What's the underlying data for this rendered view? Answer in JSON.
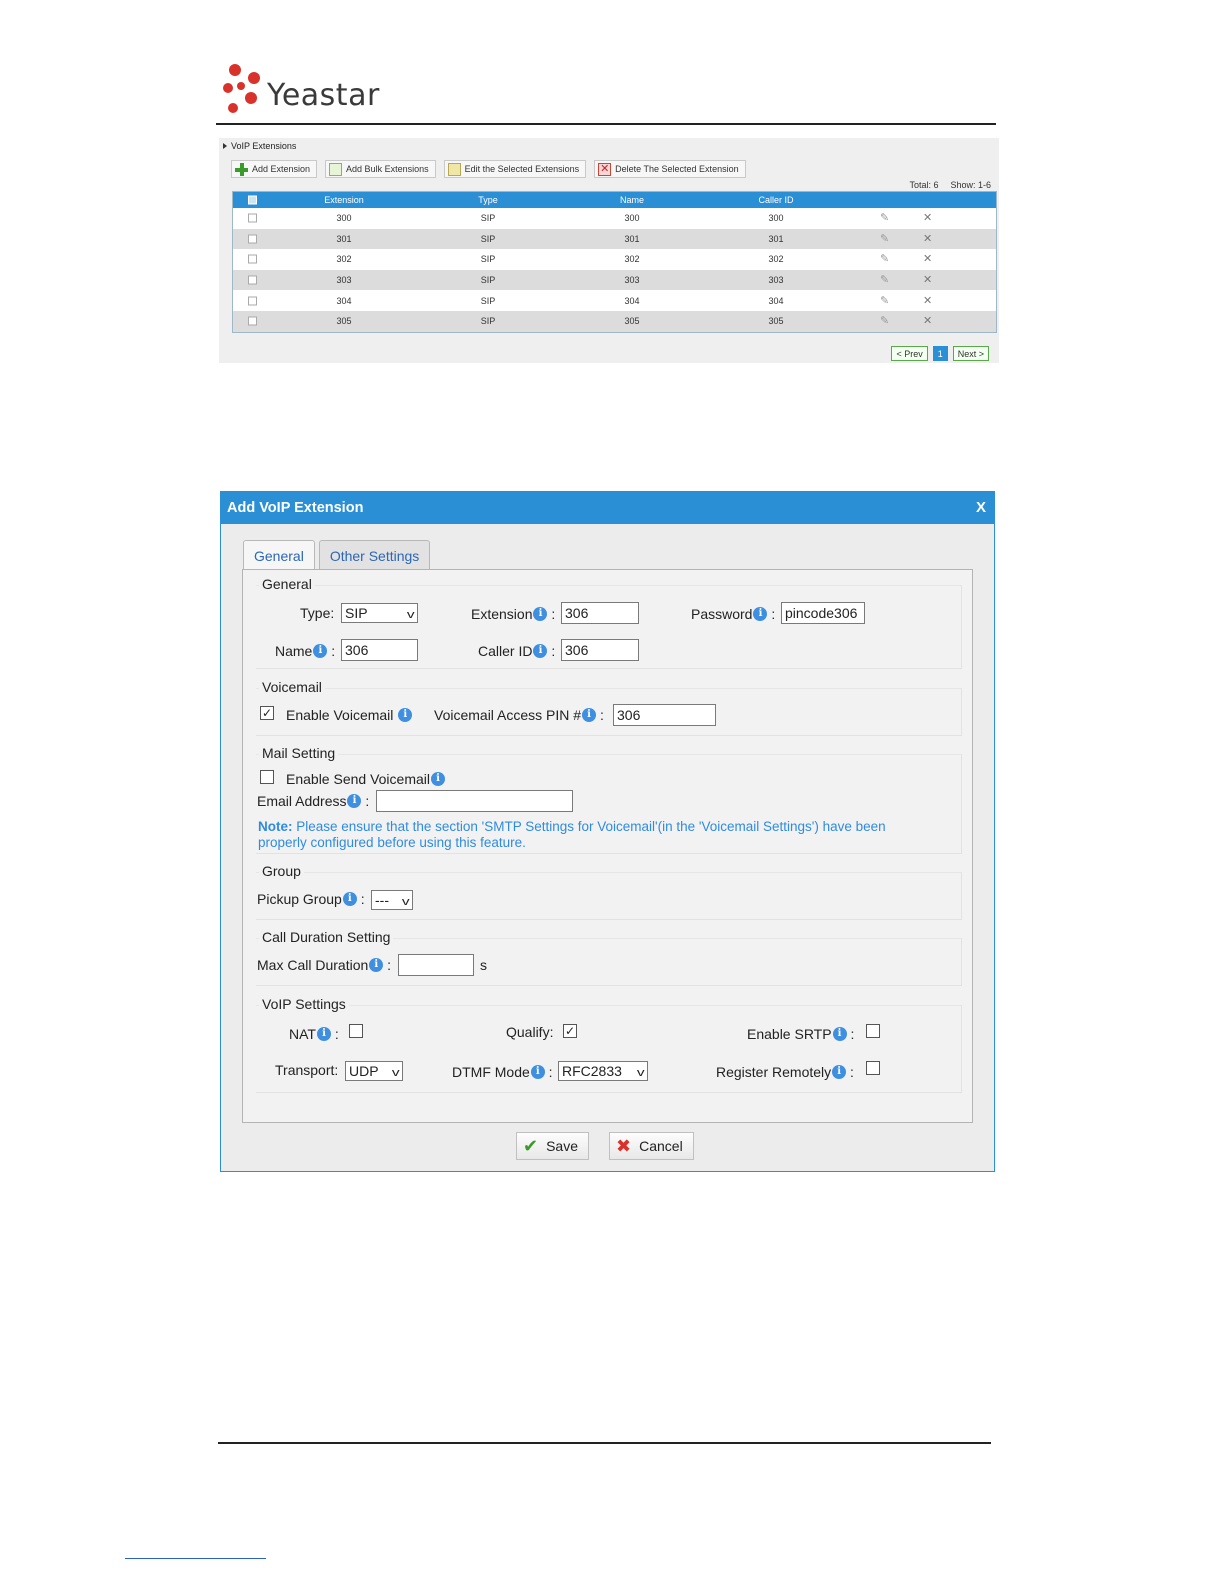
{
  "brand": {
    "name": "Yeastar",
    "accent": "#d8322b"
  },
  "ext_list": {
    "title": "VoIP Extensions",
    "toolbar": [
      {
        "label": "Add Extension",
        "icon": "plus-icon"
      },
      {
        "label": "Add Bulk Extensions",
        "icon": "bulk-icon"
      },
      {
        "label": "Edit the Selected Extensions",
        "icon": "edit-icon"
      },
      {
        "label": "Delete The Selected Extension",
        "icon": "delete-icon"
      }
    ],
    "total": "Total: 6",
    "show": "Show: 1-6",
    "columns": [
      "Extension",
      "Type",
      "Name",
      "Caller ID"
    ],
    "rows": [
      {
        "extension": "300",
        "type": "SIP",
        "name": "300",
        "caller_id": "300"
      },
      {
        "extension": "301",
        "type": "SIP",
        "name": "301",
        "caller_id": "301"
      },
      {
        "extension": "302",
        "type": "SIP",
        "name": "302",
        "caller_id": "302"
      },
      {
        "extension": "303",
        "type": "SIP",
        "name": "303",
        "caller_id": "303"
      },
      {
        "extension": "304",
        "type": "SIP",
        "name": "304",
        "caller_id": "304"
      },
      {
        "extension": "305",
        "type": "SIP",
        "name": "305",
        "caller_id": "305"
      }
    ],
    "pager": {
      "prev": "< Prev",
      "page": "1",
      "next": "Next >"
    }
  },
  "dialog": {
    "title": "Add VoIP Extension",
    "close": "X",
    "tabs": [
      "General",
      "Other Settings"
    ],
    "general": {
      "legend": "General",
      "type_label": "Type:",
      "type_value": "SIP",
      "extension_label": "Extension",
      "extension_value": "306",
      "password_label": "Password",
      "password_value": "pincode306",
      "name_label": "Name",
      "name_value": "306",
      "caller_id_label": "Caller ID",
      "caller_id_value": "306"
    },
    "voicemail": {
      "legend": "Voicemail",
      "enable_label": "Enable Voicemail",
      "enable_checked": true,
      "pin_label": "Voicemail Access PIN #",
      "pin_value": "306"
    },
    "mail": {
      "legend": "Mail Setting",
      "send_label": "Enable Send Voicemail",
      "send_checked": false,
      "email_label": "Email Address",
      "email_value": "",
      "note_prefix": "Note:",
      "note_text": " Please ensure that the section 'SMTP Settings for Voicemail'(in the 'Voicemail Settings') have been properly configured before using this feature."
    },
    "group": {
      "legend": "Group",
      "pickup_label": "Pickup Group",
      "pickup_value": "---"
    },
    "call_duration": {
      "legend": "Call Duration Setting",
      "max_label": "Max Call Duration",
      "max_value": "",
      "unit": "s"
    },
    "voip": {
      "legend": "VoIP Settings",
      "nat_label": "NAT",
      "nat_checked": false,
      "qualify_label": "Qualify:",
      "qualify_checked": true,
      "srtp_label": "Enable SRTP",
      "srtp_checked": false,
      "transport_label": "Transport:",
      "transport_value": "UDP",
      "dtmf_label": "DTMF Mode",
      "dtmf_value": "RFC2833",
      "register_label": "Register Remotely",
      "register_checked": false
    },
    "buttons": {
      "save": "Save",
      "cancel": "Cancel"
    }
  }
}
